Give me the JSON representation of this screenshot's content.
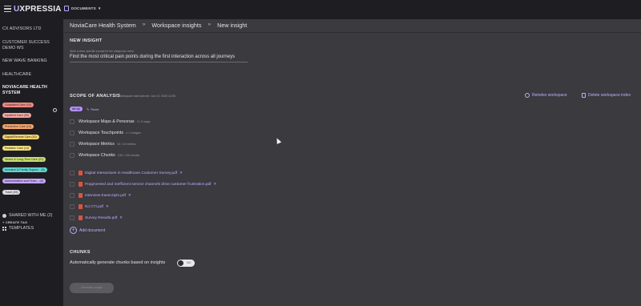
{
  "app": {
    "logo_prefix": "U",
    "logo_rest": "XPRESSIA"
  },
  "doc_switch": {
    "label": "DOCUMENTS"
  },
  "sidebar": {
    "workspaces": [
      {
        "label": "CX ADVISORS LTD"
      },
      {
        "label": "CUSTOMER SUCCESS DEMO WS"
      },
      {
        "label": "NEW WAVE BANKING"
      },
      {
        "label": "HEALTHCARE"
      },
      {
        "label": "NOVIACARE HEALTH SYSTEM"
      }
    ],
    "tags": [
      {
        "label": "Outpatient Care (16)",
        "color": "#f28b82"
      },
      {
        "label": "Inpatient Care (35)",
        "color": "#f7a8a0"
      },
      {
        "label": "Preventive Care (24)",
        "color": "#f6a56a"
      },
      {
        "label": "Digital/Remote Care (30)",
        "color": "#f5d26a"
      },
      {
        "label": "Pediatric Care (14)",
        "color": "#f3e07a"
      },
      {
        "label": "Senior & Long-Term Care (21)",
        "color": "#c9df6a"
      },
      {
        "label": "Inclusive & Family Suppor... (8)",
        "color": "#5fd6d0"
      },
      {
        "label": "Administrative and Finan... (8)",
        "color": "#c6a6ff"
      },
      {
        "label": "Trash (39)",
        "color": "#dcdce0"
      }
    ],
    "create_tag": "+ CREATE TAG",
    "shared": "SHARED WITH ME (2)",
    "templates": "TEMPLATES"
  },
  "breadcrumbs": [
    "NoviaCare Health System",
    "Workspace insights",
    "New insight"
  ],
  "new_insight": {
    "title": "NEW INSIGHT",
    "field_label": "Write a clear, specific prompt for the insight you need",
    "field_value": "Find the most critical pain points during the first interaction across all journeys"
  },
  "scope": {
    "title": "SCOPE OF ANALYSIS",
    "last_indexed": "Workspace last indexed: Jun 10, 2025 14:06",
    "action_reindex": "Reindex workspace",
    "action_delete": "Delete workspace index",
    "all_pill": "All (4)",
    "reset": "Reset",
    "checks": [
      {
        "label": "Workspace Maps & Personas",
        "count": "3 / 3 maps"
      },
      {
        "label": "Workspace Touchpoints",
        "count": "4 / 4 stages"
      },
      {
        "label": "Workspace Metrics",
        "count": "15 / 15 metrics"
      },
      {
        "label": "Workspace Chunks",
        "count": "130 / 130 chunks"
      }
    ],
    "documents": [
      {
        "label": "Digital Interactions in Healthcare Customer Survey.pdf"
      },
      {
        "label": "Fragmented and Inefficient service channels drive customer frustration.pdf"
      },
      {
        "label": "Interview-transcripts.pdf"
      },
      {
        "label": "NJ CTI.pdf"
      },
      {
        "label": "Survey Results.pdf"
      }
    ],
    "add_document": "Add document"
  },
  "chunks": {
    "title": "CHUNKS",
    "auto_label": "Automatically generate chunks based on insights",
    "toggle_label": "NO"
  },
  "generate_button": "Generate insight"
}
